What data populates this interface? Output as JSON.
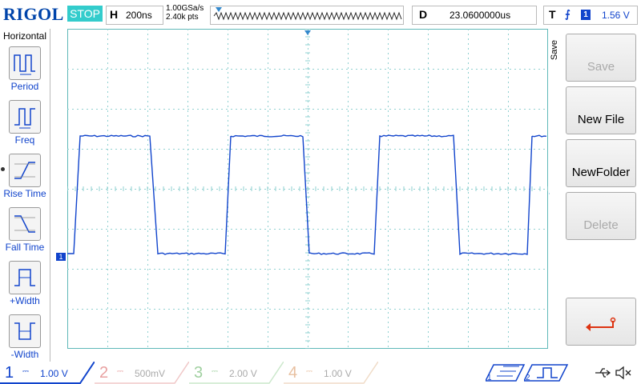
{
  "brand": "RIGOL",
  "run_state": "STOP",
  "horizontal": {
    "key": "H",
    "timebase": "200ns",
    "sample_rate": "1.00GSa/s",
    "mem_depth": "2.40k pts"
  },
  "delay": {
    "key": "D",
    "value": "23.0600000us"
  },
  "trigger": {
    "key": "T",
    "channel": "1",
    "level": "1.56 V"
  },
  "left_menu": {
    "title": "Horizontal",
    "items": [
      {
        "label": "Period"
      },
      {
        "label": "Freq"
      },
      {
        "label": "Rise Time"
      },
      {
        "label": "Fall Time"
      },
      {
        "label": "+Width"
      },
      {
        "label": "-Width"
      }
    ]
  },
  "right_menu": {
    "side_label": "Save",
    "buttons": [
      {
        "label": "Save",
        "enabled": false
      },
      {
        "label": "New File",
        "enabled": true
      },
      {
        "label": "NewFolder",
        "enabled": true
      },
      {
        "label": "Delete",
        "enabled": false
      },
      {
        "label": "",
        "icon": "return-arrow-icon",
        "enabled": true
      }
    ]
  },
  "channels": [
    {
      "num": "1",
      "scale": "1.00 V",
      "active": true,
      "color": "#1144cc"
    },
    {
      "num": "2",
      "scale": "500mV",
      "active": false,
      "color": "#e8a0a0"
    },
    {
      "num": "3",
      "scale": "2.00 V",
      "active": false,
      "color": "#a0d0a0"
    },
    {
      "num": "4",
      "scale": "1.00 V",
      "active": false,
      "color": "#e8c0a0"
    }
  ],
  "markers": {
    "ch1_ground": "1"
  },
  "colors": {
    "trace": "#1144cc",
    "grid": "#8fd0d0",
    "accent": "#33cccc"
  },
  "waveform": {
    "type": "square",
    "channel": "1",
    "periods_visible": 3.1
  }
}
